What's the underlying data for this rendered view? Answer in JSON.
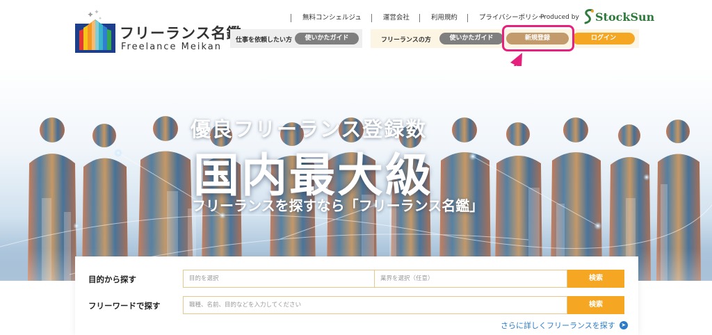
{
  "header": {
    "logo": {
      "name_jp": "フリーランス名鑑",
      "name_en": "Freelance Meikan",
      "icon": "book-logo-icon"
    },
    "top_nav": [
      {
        "label": "無料コンシェルジュ"
      },
      {
        "label": "運営会社"
      },
      {
        "label": "利用規約"
      },
      {
        "label": "プライバシーポリシー"
      }
    ],
    "produced_by": "Produced by",
    "producer_logo": "StockSun",
    "client_group": {
      "label": "仕事を依頼したい方",
      "guide_button": "使いかたガイド"
    },
    "freelancer_group": {
      "label": "フリーランスの方",
      "guide_button": "使いかたガイド",
      "register_button": "新規登録",
      "login_button": "ログイン"
    }
  },
  "hero": {
    "line1": "優良フリーランス登録数",
    "line2": "国内最大級",
    "line3": "フリーランスを探すなら「フリーランス名鑑」"
  },
  "search": {
    "purpose_label": "目的から探す",
    "purpose_placeholder": "目的を選択",
    "industry_placeholder": "業界を選択（任意）",
    "search_button": "検索",
    "freeword_label": "フリーワードで探す",
    "freeword_placeholder": "職種、名前、目的などを入力してください",
    "search_button_2": "検索",
    "more_link": "さらに詳しくフリーランスを探す",
    "more_icon": "arrow-circle-right-icon"
  },
  "colors": {
    "accent_orange": "#f5a623",
    "register_tan": "#c39a6b",
    "highlight_pink": "#e6217d",
    "link_blue": "#2b7bc8",
    "stocksun_green": "#2f7a3c"
  }
}
